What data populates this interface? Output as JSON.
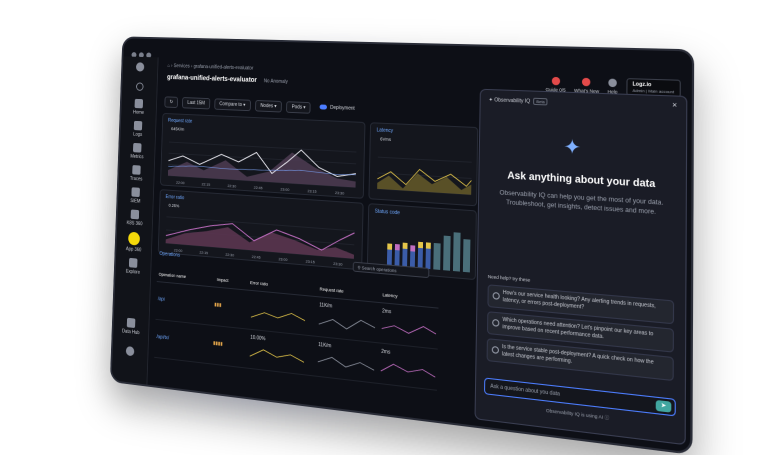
{
  "breadcrumb": {
    "home": "⌂",
    "section": "Services",
    "leaf": "grafana-unified-alerts-evaluator"
  },
  "page": {
    "title": "grafana-unified-alerts-evaluator",
    "anomaly": "No Anomaly"
  },
  "topbar": {
    "guide": "Guide 0/5",
    "whats_new": "What's New",
    "help": "Help",
    "logo_name": "Logz.io",
    "logo_sub": "Admin",
    "logo_account": "Main account"
  },
  "sidebar": [
    {
      "label": "Home",
      "icon": "home-icon"
    },
    {
      "label": "Logs",
      "icon": "logs-icon"
    },
    {
      "label": "Metrics",
      "icon": "metrics-icon"
    },
    {
      "label": "Traces",
      "icon": "traces-icon"
    },
    {
      "label": "SIEM",
      "icon": "siem-icon"
    },
    {
      "label": "K8S 360",
      "icon": "k8s-icon"
    },
    {
      "label": "App 360",
      "icon": "app-icon",
      "active": true
    },
    {
      "label": "Explore",
      "icon": "explore-icon"
    },
    {
      "label": "Data Hub",
      "icon": "data-hub-icon"
    },
    {
      "label": "",
      "icon": "settings-icon"
    }
  ],
  "filters": {
    "time": "Last 15M",
    "compare": "Compare to",
    "nodes": "Nodes",
    "pods": "Pods",
    "deployment": "Deployment"
  },
  "panels": {
    "request_rate": {
      "title": "Request rate",
      "value": "645K/m",
      "ticks": [
        "22:00",
        "22:15",
        "22:30",
        "22:45",
        "23:00",
        "23:15",
        "23:30"
      ]
    },
    "latency": {
      "title": "Latency",
      "value": "6Vms"
    },
    "error_ratio": {
      "title": "Error ratio",
      "value": "0.25%",
      "ticks": [
        "22:00",
        "22:15",
        "22:30",
        "22:45",
        "23:00",
        "23:15",
        "23:30"
      ]
    },
    "status_code": {
      "title": "Status code"
    }
  },
  "operations": {
    "title": "Operations",
    "search": "Search operations",
    "columns": [
      "Operation name",
      "Impact",
      "Error ratio",
      "Request rate",
      "Latency"
    ],
    "rows": [
      {
        "name": "/api",
        "error_ratio": "",
        "request_rate": "11K/m",
        "latency": "2ms"
      },
      {
        "name": "/api/tx/",
        "error_ratio": "10.00%",
        "request_rate": "11K/m",
        "latency": "2ms"
      }
    ]
  },
  "ai_panel": {
    "header": "Observability IQ",
    "beta": "Beta",
    "title": "Ask anything about your data",
    "description": "Observability IQ can help you get the most of your data. Troubleshoot, get insights, detect issues and more.",
    "help_label": "Need help? try these",
    "suggestions": [
      "How's our service health looking? Any alerting trends in requests, latency, or errors post-deployment?",
      "Which operations need attention? Let's pinpoint our key areas to improve based on recent performance data.",
      "Is the service stable post-deployment? A quick check on how the latest changes are performing."
    ],
    "placeholder": "Ask a question about you data",
    "footer": "Observability IQ is using AI"
  }
}
